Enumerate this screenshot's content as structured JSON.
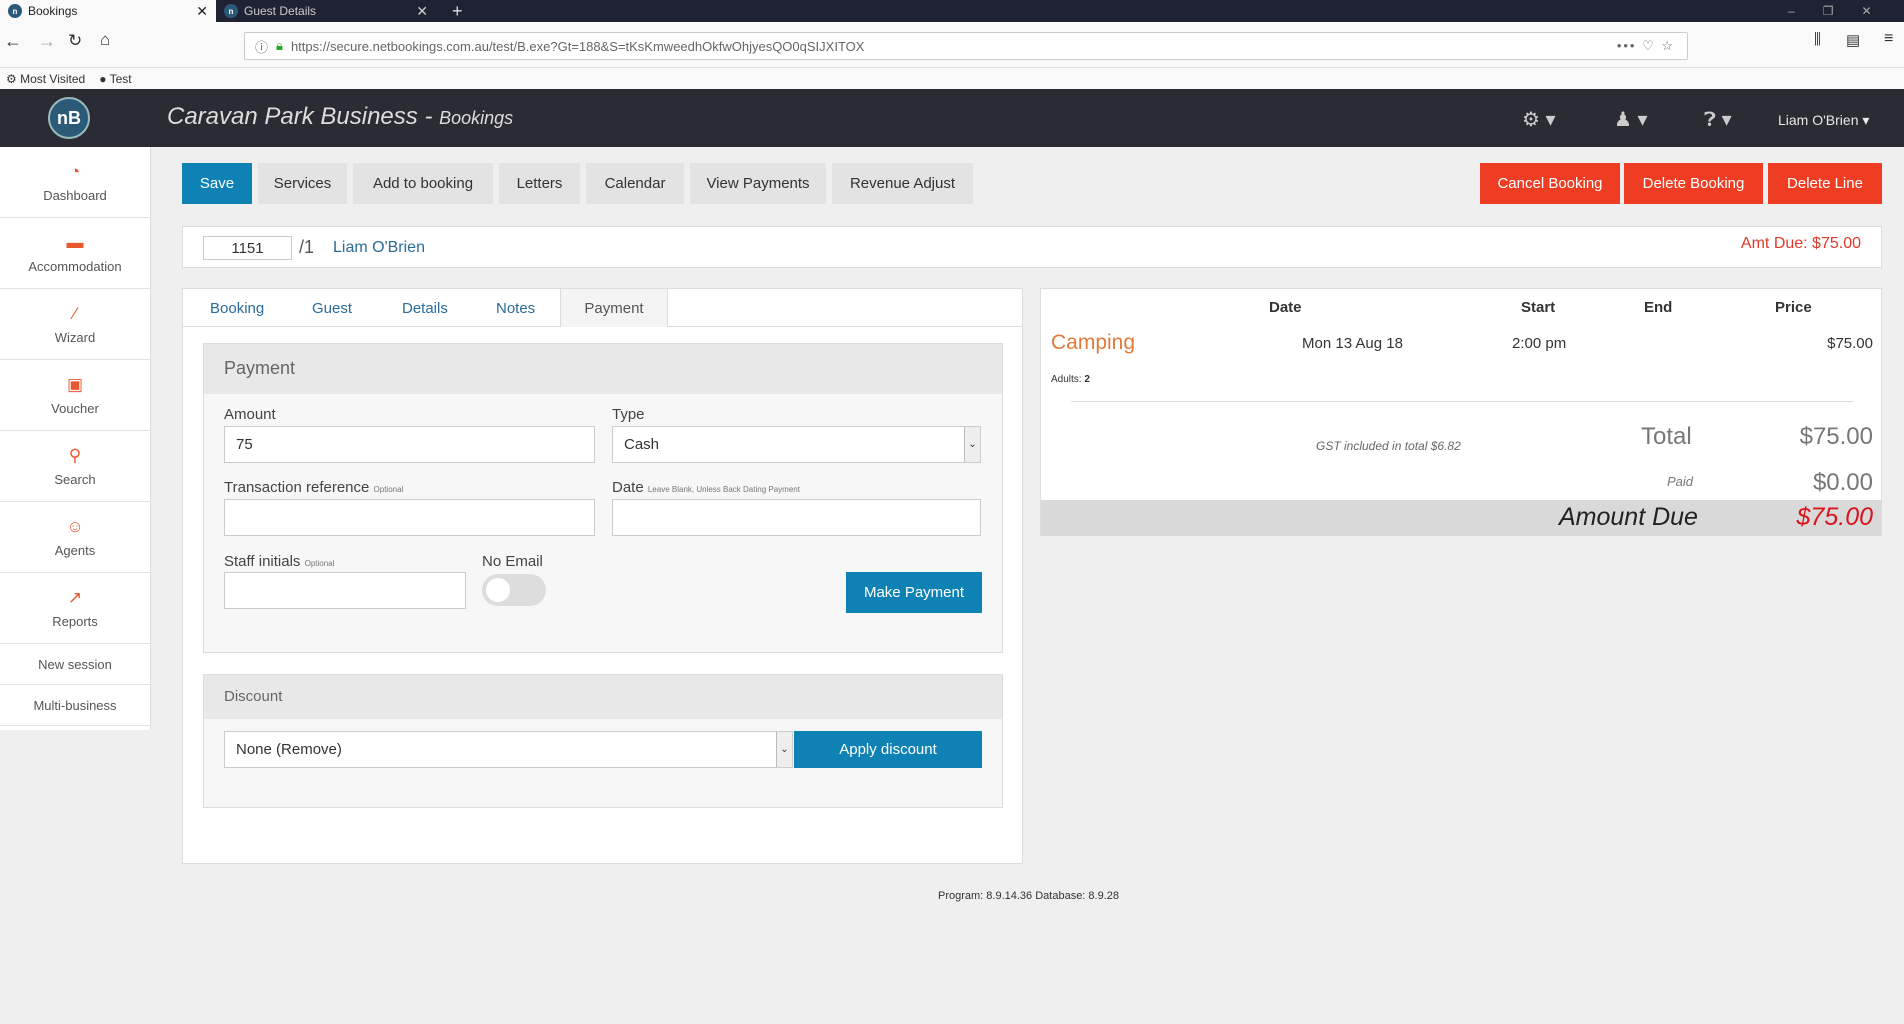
{
  "browser": {
    "tabs": [
      {
        "title": "Bookings"
      },
      {
        "title": "Guest Details"
      }
    ],
    "url": "https://secure.netbookings.com.au/test/B.exe?Gt=188&S=tKsKmweedhOkfwOhjyesQO0qSIJXITOX",
    "bookmarks": [
      "Most Visited",
      "Test"
    ]
  },
  "header": {
    "title": "Caravan Park Business - ",
    "subtitle": "Bookings",
    "user": "Liam O'Brien",
    "logo": "nB"
  },
  "sidebar": {
    "items": [
      {
        "label": "Dashboard",
        "icon": "dashboard-icon"
      },
      {
        "label": "Accommodation",
        "icon": "bed-icon"
      },
      {
        "label": "Wizard",
        "icon": "wand-icon"
      },
      {
        "label": "Voucher",
        "icon": "gift-icon"
      },
      {
        "label": "Search",
        "icon": "search-icon"
      },
      {
        "label": "Agents",
        "icon": "agent-icon"
      },
      {
        "label": "Reports",
        "icon": "chart-icon"
      },
      {
        "label": "New session"
      },
      {
        "label": "Multi-business"
      }
    ]
  },
  "toolbar": {
    "save": "Save",
    "services": "Services",
    "add": "Add to booking",
    "letters": "Letters",
    "calendar": "Calendar",
    "payments": "View Payments",
    "revenue": "Revenue Adjust",
    "cancel": "Cancel Booking",
    "delete_booking": "Delete Booking",
    "delete_line": "Delete Line"
  },
  "booking": {
    "id": "1151",
    "line": "/1",
    "guest": "Liam O'Brien",
    "amt_due": "Amt Due: $75.00"
  },
  "tabs": [
    "Booking",
    "Guest",
    "Details",
    "Notes",
    "Payment"
  ],
  "payment": {
    "title": "Payment",
    "amount_label": "Amount",
    "amount": "75",
    "type_label": "Type",
    "type": "Cash",
    "ref_label": "Transaction reference",
    "optional": "Optional",
    "date_label": "Date",
    "date_hint": "Leave Blank, Unless Back Dating Payment",
    "staff_label": "Staff initials",
    "no_email": "No Email",
    "no_email_on": false,
    "make_payment": "Make Payment"
  },
  "discount": {
    "title": "Discount",
    "selected": "None (Remove)",
    "apply": "Apply discount"
  },
  "summary": {
    "headers": [
      "Date",
      "Start",
      "End",
      "Price"
    ],
    "item": "Camping",
    "date": "Mon 13 Aug 18",
    "start": "2:00 pm",
    "end": "",
    "price": "$75.00",
    "adults_label": "Adults:",
    "adults": "2",
    "gst": "GST included in total $6.82",
    "total_label": "Total",
    "total": "$75.00",
    "paid_label": "Paid",
    "paid": "$0.00",
    "due_label": "Amount Due",
    "due": "$75.00"
  },
  "footer": "Program: 8.9.14.36 Database: 8.9.28",
  "colors": {
    "accent": "#0f82b5",
    "danger": "#ef3d24",
    "header": "#2a2b33",
    "camping": "#e07b3c"
  }
}
